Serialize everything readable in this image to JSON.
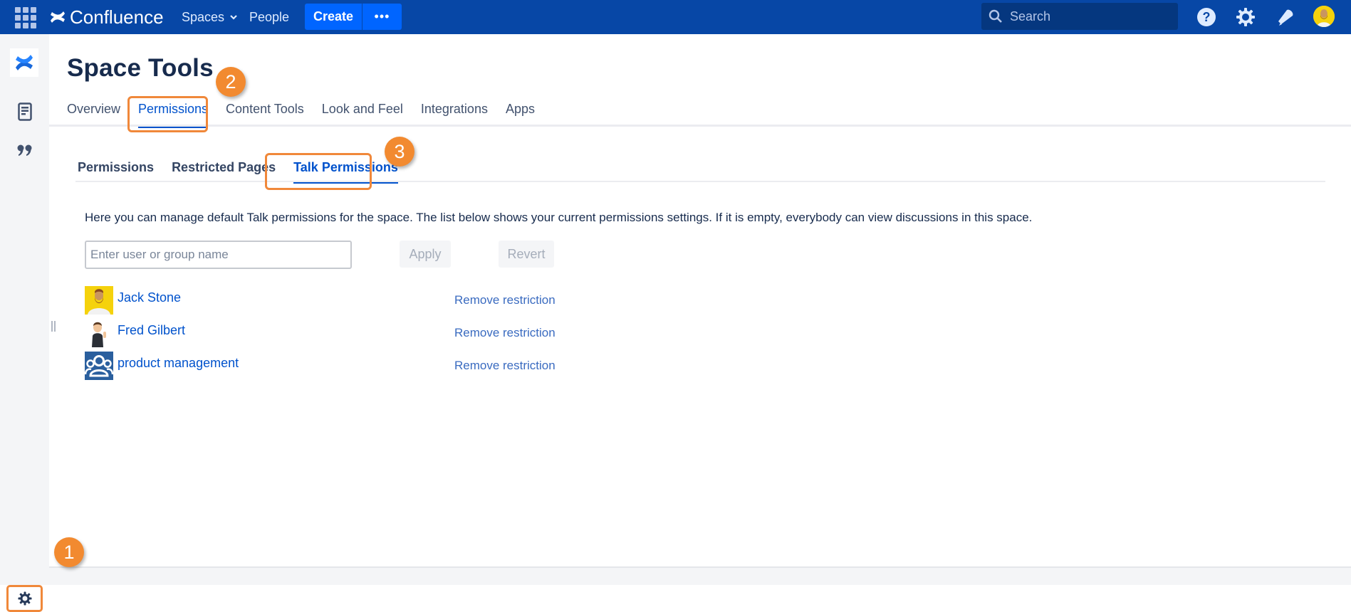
{
  "topbar": {
    "apps_icon": "app-switcher-icon",
    "product_name": "Confluence",
    "nav": [
      {
        "label": "Spaces",
        "has_dropdown": true
      },
      {
        "label": "People",
        "has_dropdown": false
      }
    ],
    "create_label": "Create",
    "more_label": "•••",
    "search_placeholder": "Search",
    "icons": [
      "help-icon",
      "settings-icon",
      "notifications-icon"
    ],
    "brand_color": "#0747a6",
    "accent_color": "#0065ff"
  },
  "sidebar": {
    "items": [
      {
        "icon": "space-logo-icon"
      },
      {
        "icon": "pages-icon"
      },
      {
        "icon": "blog-quote-icon"
      }
    ],
    "footer_icon": "space-settings-gear-icon"
  },
  "page": {
    "title": "Space Tools",
    "tabs": [
      {
        "label": "Overview",
        "active": false
      },
      {
        "label": "Permissions",
        "active": true
      },
      {
        "label": "Content Tools",
        "active": false
      },
      {
        "label": "Look and Feel",
        "active": false
      },
      {
        "label": "Integrations",
        "active": false
      },
      {
        "label": "Apps",
        "active": false
      }
    ],
    "subtabs": [
      {
        "label": "Permissions",
        "active": false
      },
      {
        "label": "Restricted Pages",
        "active": false
      },
      {
        "label": "Talk Permissions",
        "active": true
      }
    ],
    "description": "Here you can manage default Talk permissions for the space. The list below shows your current permissions settings. If it is empty, everybody can view discussions in this space.",
    "input_placeholder": "Enter user or group name",
    "input_value": "",
    "apply_label": "Apply",
    "revert_label": "Revert",
    "permissions": [
      {
        "name": "Jack Stone",
        "type": "user",
        "action": "Remove restriction"
      },
      {
        "name": "Fred Gilbert",
        "type": "user",
        "action": "Remove restriction"
      },
      {
        "name": "product management",
        "type": "group",
        "action": "Remove restriction"
      }
    ]
  },
  "annotations": {
    "step_1": "1",
    "step_2": "2",
    "step_3": "3",
    "highlight_color": "#f0883a"
  }
}
